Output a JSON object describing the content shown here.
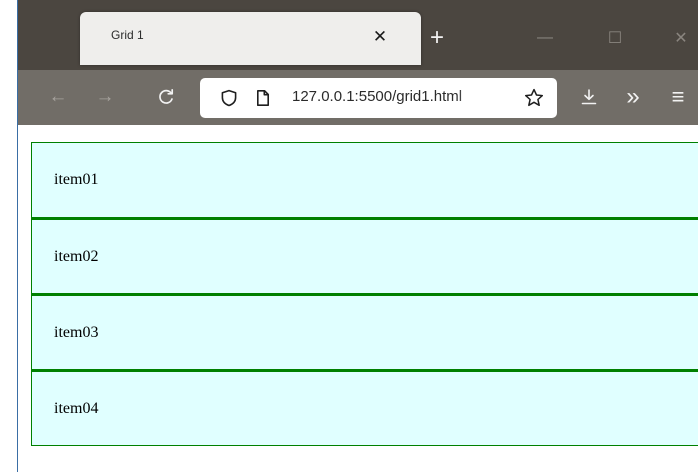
{
  "browser": {
    "tab": {
      "title": "Grid 1",
      "close_glyph": "✕"
    },
    "new_tab_glyph": "+",
    "window_controls": {
      "minimize_glyph": "—",
      "maximize_glyph": "☐",
      "close_glyph": "✕"
    },
    "nav": {
      "back_glyph": "←",
      "forward_glyph": "→",
      "reload_glyph": "C",
      "overflow_glyph": "»",
      "menu_glyph": "≡"
    },
    "url": "127.0.0.1:5500/grid1.html"
  },
  "page": {
    "items": [
      {
        "label": "item01"
      },
      {
        "label": "item02"
      },
      {
        "label": "item03"
      },
      {
        "label": "item04"
      }
    ]
  },
  "colors": {
    "item_background": "#e0ffff",
    "item_border": "#008000",
    "tab_strip": "#4b4640",
    "nav_bar": "#716d67"
  },
  "icons": {
    "tab_close": "close-icon",
    "new_tab": "plus-icon",
    "minimize": "minimize-icon",
    "maximize": "maximize-icon",
    "window_close": "close-icon",
    "back": "arrow-left-icon",
    "forward": "arrow-right-icon",
    "reload": "reload-icon",
    "tracking_protection": "shield-icon",
    "page_info": "page-icon",
    "bookmark": "star-icon",
    "downloads": "download-icon",
    "overflow": "chevron-double-right-icon",
    "menu": "hamburger-menu-icon"
  }
}
